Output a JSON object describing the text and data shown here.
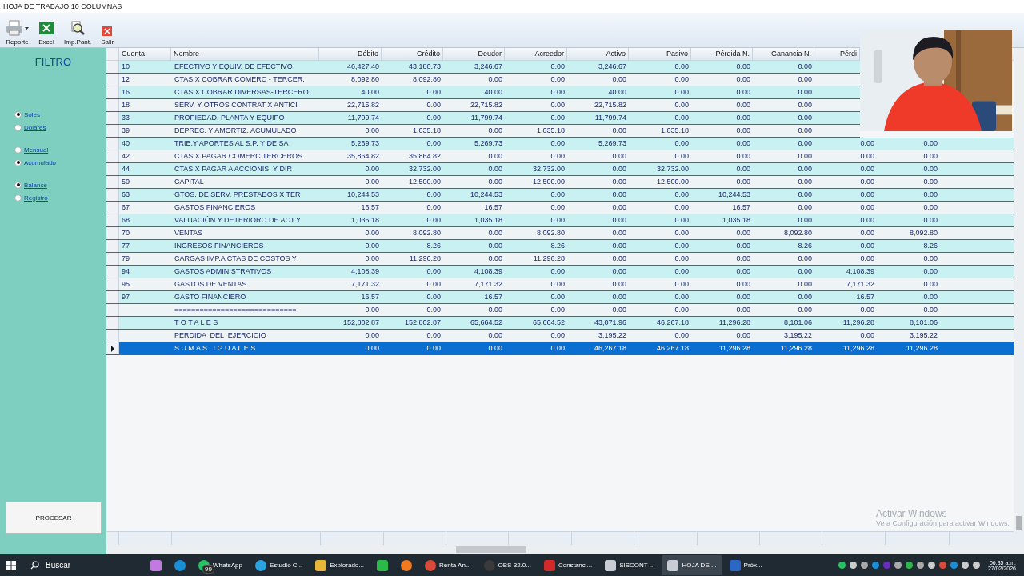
{
  "window": {
    "title": "HOJA DE TRABAJO 10 COLUMNAS"
  },
  "toolbar": [
    {
      "label": "Reporte",
      "kind": "printer",
      "dropdown": true
    },
    {
      "label": "Excel",
      "kind": "excel",
      "dropdown": false
    },
    {
      "label": "Imp.Pant.",
      "kind": "preview",
      "dropdown": false
    },
    {
      "label": "Salir",
      "kind": "exit",
      "dropdown": false
    }
  ],
  "filter": {
    "title": "FILTRO",
    "groups": [
      [
        {
          "label": "Soles",
          "selected": true
        },
        {
          "label": "Dólares",
          "selected": false
        }
      ],
      [
        {
          "label": "Mensual",
          "selected": false
        },
        {
          "label": "Acumulado",
          "selected": true
        }
      ],
      [
        {
          "label": "Balance",
          "selected": true
        },
        {
          "label": "Registro",
          "selected": false
        }
      ]
    ],
    "button": "PROCESAR"
  },
  "table": {
    "columns": [
      "Cuenta",
      "Nombre",
      "Débito",
      "Crédito",
      "Deudor",
      "Acreedor",
      "Activo",
      "Pasivo",
      "Pérdida N.",
      "Ganancia N.",
      "Pérdi"
    ],
    "rows": [
      {
        "cuenta": "10",
        "nombre": "EFECTIVO Y EQUIV. DE EFECTIVO",
        "values": [
          "46,427.40",
          "43,180.73",
          "3,246.67",
          "0.00",
          "3,246.67",
          "0.00",
          "0.00",
          "0.00"
        ],
        "selected": false
      },
      {
        "cuenta": "12",
        "nombre": "CTAS X COBRAR COMERC - TERCER.",
        "values": [
          "8,092.80",
          "8,092.80",
          "0.00",
          "0.00",
          "0.00",
          "0.00",
          "0.00",
          "0.00"
        ],
        "selected": false
      },
      {
        "cuenta": "16",
        "nombre": "CTAS X COBRAR DIVERSAS-TERCERO",
        "values": [
          "40.00",
          "0.00",
          "40.00",
          "0.00",
          "40.00",
          "0.00",
          "0.00",
          "0.00"
        ],
        "selected": false
      },
      {
        "cuenta": "18",
        "nombre": "SERV. Y OTROS CONTRAT X ANTICI",
        "values": [
          "22,715.82",
          "0.00",
          "22,715.82",
          "0.00",
          "22,715.82",
          "0.00",
          "0.00",
          "0.00"
        ],
        "selected": false
      },
      {
        "cuenta": "33",
        "nombre": "PROPIEDAD, PLANTA Y EQUIPO",
        "values": [
          "11,799.74",
          "0.00",
          "11,799.74",
          "0.00",
          "11,799.74",
          "0.00",
          "0.00",
          "0.00"
        ],
        "selected": false
      },
      {
        "cuenta": "39",
        "nombre": "DEPREC. Y AMORTIZ. ACUMULADO",
        "values": [
          "0.00",
          "1,035.18",
          "0.00",
          "1,035.18",
          "0.00",
          "1,035.18",
          "0.00",
          "0.00"
        ],
        "selected": false
      },
      {
        "cuenta": "40",
        "nombre": "TRIB.Y APORTES AL S.P. Y DE SA",
        "values": [
          "5,269.73",
          "0.00",
          "5,269.73",
          "0.00",
          "5,269.73",
          "0.00",
          "0.00",
          "0.00",
          "0.00",
          "0.00"
        ],
        "selected": false
      },
      {
        "cuenta": "42",
        "nombre": "CTAS X PAGAR COMERC TERCEROS",
        "values": [
          "35,864.82",
          "35,864.82",
          "0.00",
          "0.00",
          "0.00",
          "0.00",
          "0.00",
          "0.00",
          "0.00",
          "0.00"
        ],
        "selected": false
      },
      {
        "cuenta": "44",
        "nombre": "CTAS X PAGAR A ACCIONIS. Y DIR",
        "values": [
          "0.00",
          "32,732.00",
          "0.00",
          "32,732.00",
          "0.00",
          "32,732.00",
          "0.00",
          "0.00",
          "0.00",
          "0.00"
        ],
        "selected": false
      },
      {
        "cuenta": "50",
        "nombre": "CAPITAL",
        "values": [
          "0.00",
          "12,500.00",
          "0.00",
          "12,500.00",
          "0.00",
          "12,500.00",
          "0.00",
          "0.00",
          "0.00",
          "0.00"
        ],
        "selected": false
      },
      {
        "cuenta": "63",
        "nombre": "GTOS. DE SERV. PRESTADOS X TER",
        "values": [
          "10,244.53",
          "0.00",
          "10,244.53",
          "0.00",
          "0.00",
          "0.00",
          "10,244.53",
          "0.00",
          "0.00",
          "0.00"
        ],
        "selected": false
      },
      {
        "cuenta": "67",
        "nombre": "GASTOS FINANCIEROS",
        "values": [
          "16.57",
          "0.00",
          "16.57",
          "0.00",
          "0.00",
          "0.00",
          "16.57",
          "0.00",
          "0.00",
          "0.00"
        ],
        "selected": false
      },
      {
        "cuenta": "68",
        "nombre": "VALUACIÓN Y DETERIORO DE ACT.Y",
        "values": [
          "1,035.18",
          "0.00",
          "1,035.18",
          "0.00",
          "0.00",
          "0.00",
          "1,035.18",
          "0.00",
          "0.00",
          "0.00"
        ],
        "selected": false
      },
      {
        "cuenta": "70",
        "nombre": "VENTAS",
        "values": [
          "0.00",
          "8,092.80",
          "0.00",
          "8,092.80",
          "0.00",
          "0.00",
          "0.00",
          "8,092.80",
          "0.00",
          "8,092.80"
        ],
        "selected": false
      },
      {
        "cuenta": "77",
        "nombre": "INGRESOS FINANCIEROS",
        "values": [
          "0.00",
          "8.26",
          "0.00",
          "8.26",
          "0.00",
          "0.00",
          "0.00",
          "8.26",
          "0.00",
          "8.26"
        ],
        "selected": false
      },
      {
        "cuenta": "79",
        "nombre": "CARGAS IMP.A CTAS DE COSTOS Y",
        "values": [
          "0.00",
          "11,296.28",
          "0.00",
          "11,296.28",
          "0.00",
          "0.00",
          "0.00",
          "0.00",
          "0.00",
          "0.00"
        ],
        "selected": false
      },
      {
        "cuenta": "94",
        "nombre": "GASTOS ADMINISTRATIVOS",
        "values": [
          "4,108.39",
          "0.00",
          "4,108.39",
          "0.00",
          "0.00",
          "0.00",
          "0.00",
          "0.00",
          "4,108.39",
          "0.00"
        ],
        "selected": false
      },
      {
        "cuenta": "95",
        "nombre": "GASTOS DE VENTAS",
        "values": [
          "7,171.32",
          "0.00",
          "7,171.32",
          "0.00",
          "0.00",
          "0.00",
          "0.00",
          "0.00",
          "7,171.32",
          "0.00"
        ],
        "selected": false
      },
      {
        "cuenta": "97",
        "nombre": "GASTO FINANCIERO",
        "values": [
          "16.57",
          "0.00",
          "16.57",
          "0.00",
          "0.00",
          "0.00",
          "0.00",
          "0.00",
          "16.57",
          "0.00"
        ],
        "selected": false
      },
      {
        "nombre": "=============================",
        "values": [
          "0.00",
          "0.00",
          "0.00",
          "0.00",
          "0.00",
          "0.00",
          "0.00",
          "0.00",
          "0.00",
          "0.00"
        ],
        "selected": false
      },
      {
        "nombre": "T O T A L E S",
        "values": [
          "152,802.87",
          "152,802.87",
          "65,664.52",
          "65,664.52",
          "43,071.96",
          "46,267.18",
          "11,296.28",
          "8,101.06",
          "11,296.28",
          "8,101.06"
        ],
        "selected": false
      },
      {
        "nombre": "PERDIDA  DEL  EJERCICIO",
        "values": [
          "0.00",
          "0.00",
          "0.00",
          "0.00",
          "3,195.22",
          "0.00",
          "0.00",
          "3,195.22",
          "0.00",
          "3,195.22"
        ],
        "selected": false
      },
      {
        "nombre": "S U M A S   I G U A L E S",
        "values": [
          "0.00",
          "0.00",
          "0.00",
          "0.00",
          "46,267.18",
          "46,267.18",
          "11,296.28",
          "11,296.28",
          "11,296.28",
          "11,296.28"
        ],
        "selected": true
      }
    ]
  },
  "activation": {
    "title": "Activar Windows",
    "subtitle": "Ve a Configuración para activar Windows."
  },
  "taskbar": {
    "search": "Buscar",
    "apps": [
      {
        "kind": "copilot",
        "active": false
      },
      {
        "kind": "edge",
        "active": false
      },
      {
        "kind": "whatsapp",
        "label": "WhatsApp",
        "badge": "99",
        "active": false
      },
      {
        "kind": "telegram",
        "label": "Estudio C...",
        "active": false
      },
      {
        "kind": "folder",
        "label": "Explorado...",
        "active": false
      },
      {
        "kind": "green",
        "active": false
      },
      {
        "kind": "firefox",
        "active": false
      },
      {
        "kind": "chrome",
        "label": "Renta An...",
        "active": false
      },
      {
        "kind": "obs",
        "label": "OBS 32.0...",
        "active": false
      },
      {
        "kind": "pdf",
        "label": "Constanci...",
        "active": false
      },
      {
        "kind": "cloud",
        "label": "SISCONT ...",
        "active": false
      },
      {
        "kind": "cloud",
        "label": "HOJA DE ...",
        "active": true
      },
      {
        "kind": "word",
        "label": "Próx...",
        "active": false
      }
    ],
    "time": "06:35 a.m.",
    "date": "27/02/2026"
  }
}
